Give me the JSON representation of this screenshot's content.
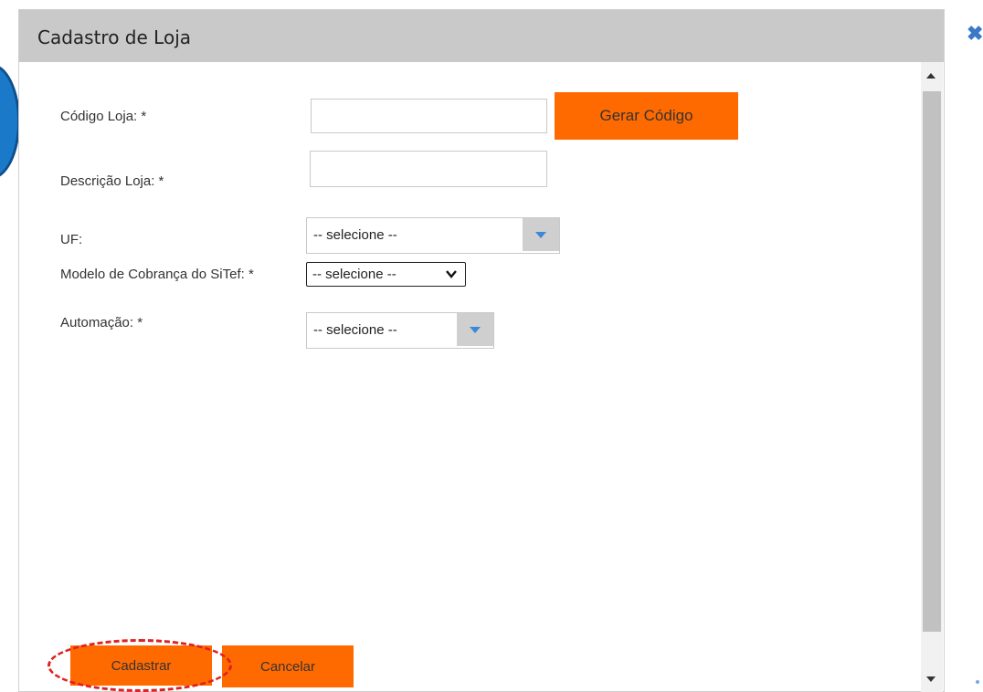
{
  "dialog": {
    "title": "Cadastro de Loja",
    "close_icon": "close-x-icon"
  },
  "form": {
    "codigo_loja": {
      "label": "Código Loja: *",
      "value": "",
      "generate_button": "Gerar Código"
    },
    "descricao_loja": {
      "label": "Descrição Loja: *",
      "value": ""
    },
    "uf": {
      "label": "UF:",
      "selected": "-- selecione --"
    },
    "modelo_cobranca": {
      "label": "Modelo de Cobrança do SiTef: *",
      "selected": "-- selecione --"
    },
    "automacao": {
      "label": "Automação: *",
      "selected": "-- selecione --"
    }
  },
  "actions": {
    "submit_label": "Cadastrar",
    "cancel_label": "Cancelar"
  },
  "colors": {
    "titlebar": "#c9c9c9",
    "accent_orange": "#ff6a00",
    "dropdown_arrow": "#3a88d6",
    "highlight_ellipse": "#e02020"
  }
}
